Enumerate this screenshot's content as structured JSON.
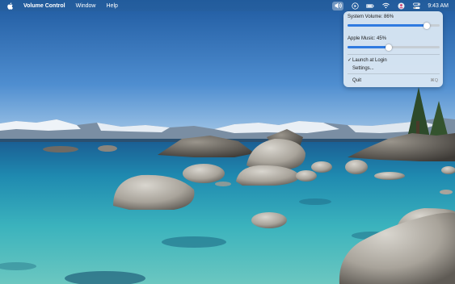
{
  "menubar": {
    "app_name": "Volume Control",
    "menus": [
      "Window",
      "Help"
    ],
    "clock": "9:43 AM"
  },
  "popover": {
    "system_volume_label": "System Volume: 86%",
    "system_volume_level": 0.86,
    "apple_music_label": "Apple Music: 45%",
    "apple_music_level": 0.45,
    "launch_at_login_label": "Launch at Login",
    "launch_at_login_checked": true,
    "check_mark": "✓",
    "settings_label": "Settings...",
    "quit_label": "Quit",
    "quit_shortcut": "⌘Q"
  },
  "colors": {
    "accent": "#2f7ae0",
    "popover_bg": "#deeaf4"
  }
}
